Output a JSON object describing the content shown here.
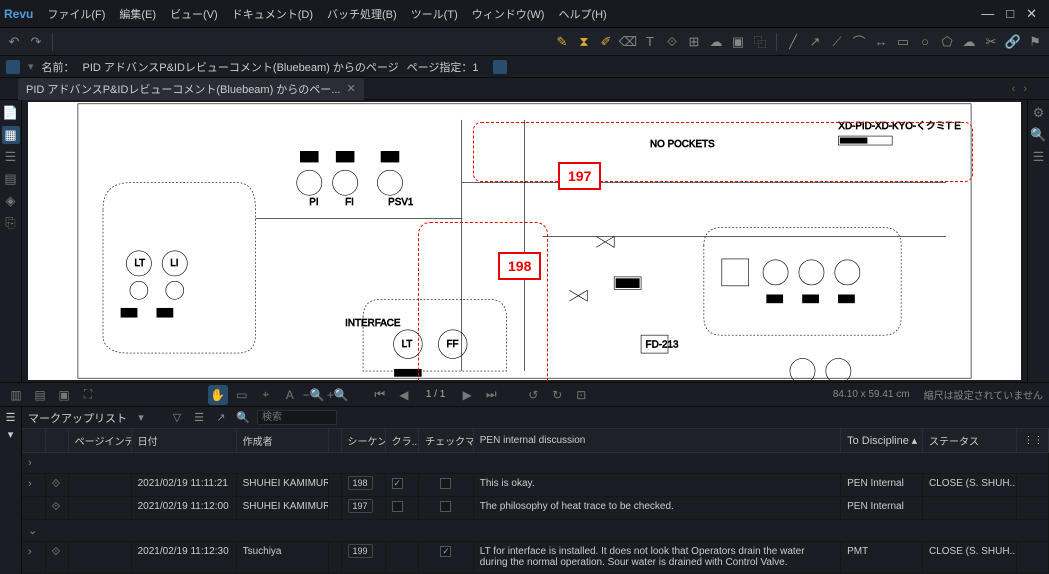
{
  "app": {
    "name": "Revu"
  },
  "menu": {
    "file": "ファイル(F)",
    "edit": "編集(E)",
    "view": "ビュー(V)",
    "document": "ドキュメント(D)",
    "batch": "バッチ処理(B)",
    "tool": "ツール(T)",
    "window": "ウィンドウ(W)",
    "help": "ヘルプ(H)"
  },
  "infobar": {
    "name_label": "名前：",
    "name_value": "PID アドバンスP&IDレビューコメント(Bluebeam) からのページ",
    "pagespec": "ページ指定：1"
  },
  "tab": {
    "label": "PID アドバンスP&IDレビューコメント(Bluebeam) からのペー..."
  },
  "callouts": {
    "c197": "197",
    "c198": "198"
  },
  "nav": {
    "page": "1 / 1",
    "coords": "84.10 x 59.41 cm",
    "scale": "縮尺は設定されていません"
  },
  "panel": {
    "title": "マークアップリスト",
    "search_placeholder": "検索"
  },
  "columns": {
    "pageindex": "ページインデッ...",
    "date": "日付",
    "author": "作成者",
    "sequence": "シーケンス",
    "class": "クラ...",
    "checkmark": "チェックマーク",
    "discussion": "PEN internal discussion",
    "todiscipline": "To Discipline",
    "status": "ステータス"
  },
  "rows": [
    {
      "date": "2021/02/19 11:11:21",
      "author": "SHUHEI KAMIMURA",
      "seq": "198",
      "chk": true,
      "disc": "This is okay.",
      "todisc": "PEN Internal",
      "status": "CLOSE (S. SHUH..."
    },
    {
      "date": "2021/02/19 11:12:00",
      "author": "SHUHEI KAMIMURA",
      "seq": "197",
      "chk": false,
      "disc": "The philosophy of heat trace to be checked.",
      "todisc": "PEN Internal",
      "status": ""
    },
    {
      "date": "2021/02/19 11:12:30",
      "author": "Tsuchiya",
      "seq": "199",
      "chk": true,
      "disc": "LT for interface is installed. It does not look that Operators drain the water during the normal operation. Sour water is drained with Control Valve.",
      "todisc": "PMT",
      "status": "CLOSE (S. SHUH..."
    }
  ]
}
